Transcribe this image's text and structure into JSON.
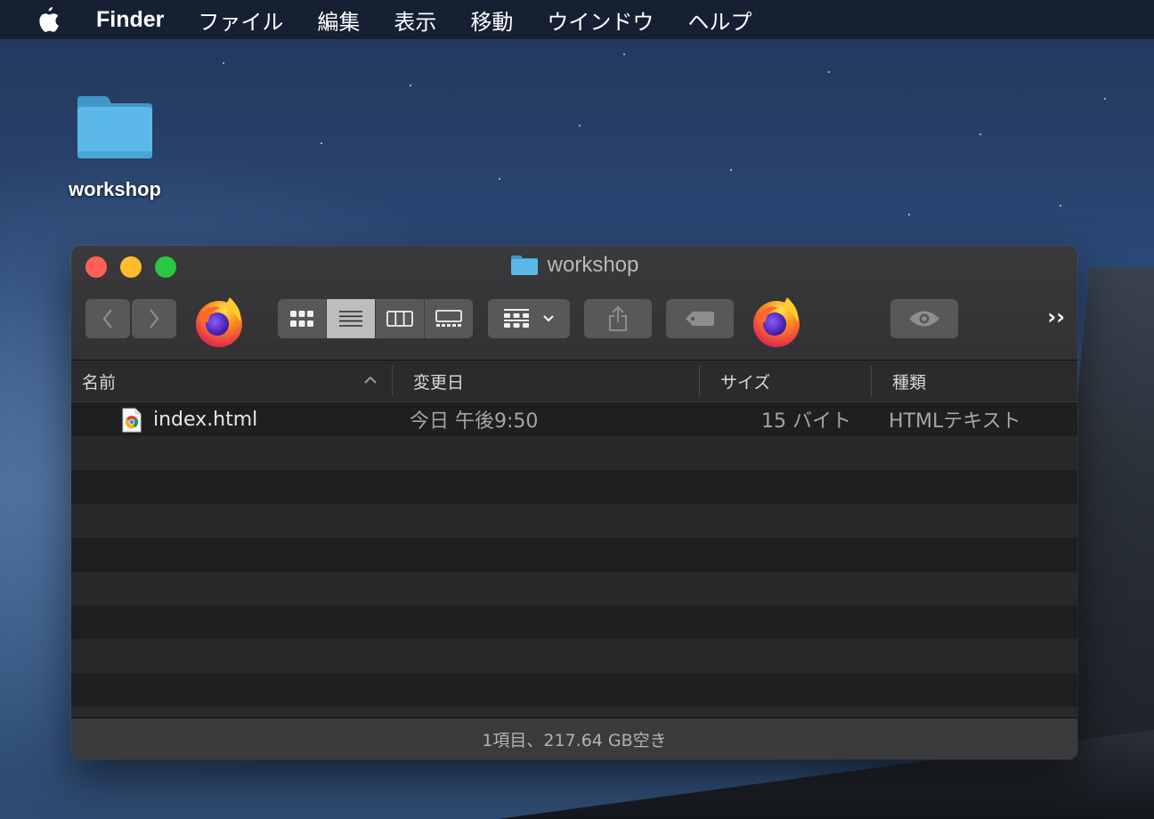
{
  "menubar": {
    "app_name": "Finder",
    "items": [
      "ファイル",
      "編集",
      "表示",
      "移動",
      "ウインドウ",
      "ヘルプ"
    ]
  },
  "desktop": {
    "folder_label": "workshop"
  },
  "window": {
    "title": "workshop",
    "columns": {
      "name": "名前",
      "modified": "変更日",
      "size": "サイズ",
      "kind": "種類"
    },
    "files": [
      {
        "name": "index.html",
        "modified": "今日 午後9:50",
        "size": "15 バイト",
        "kind": "HTMLテキスト"
      }
    ],
    "status": "1項目、217.64 GB空き"
  },
  "colors": {
    "close": "#fe5f57",
    "minimize": "#febc2e",
    "zoom": "#28c840",
    "folder": "#5cb8e8"
  }
}
